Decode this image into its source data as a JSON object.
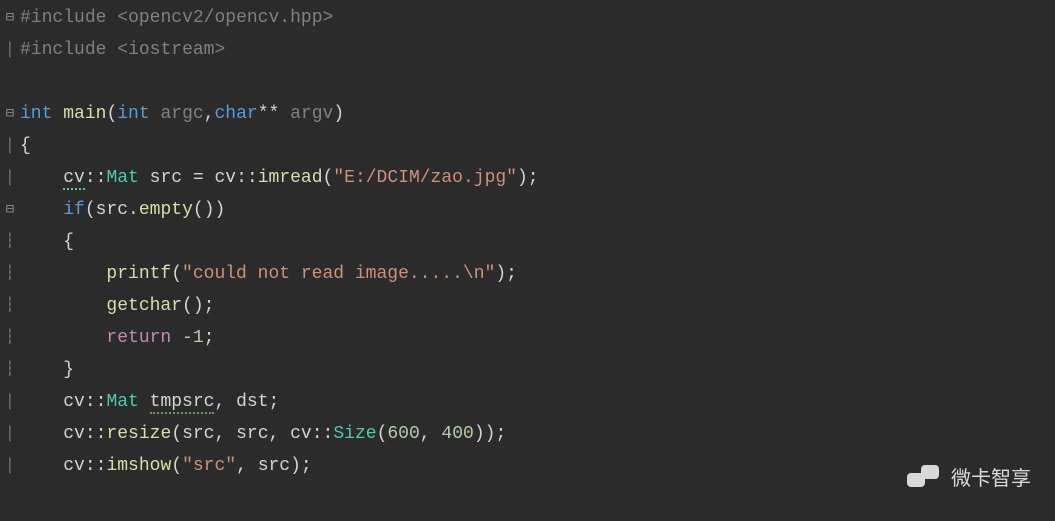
{
  "code": {
    "l1": {
      "hash": "#",
      "include": "include",
      "open": "<",
      "path": "opencv2/opencv.hpp",
      "close": ">"
    },
    "l2": {
      "hash": "#",
      "include": "include",
      "open": "<",
      "path": "iostream",
      "close": ">"
    },
    "l4": {
      "kw_int": "int",
      "main": "main",
      "lp": "(",
      "kw_int2": "int",
      "argc": "argc",
      "comma": ",",
      "kw_char": "char",
      "stars": "**",
      "argv": "argv",
      "rp": ")"
    },
    "l5": {
      "brace": "{"
    },
    "l6": {
      "ns": "cv",
      "dcolon": "::",
      "cls": "Mat",
      "var": "src",
      "eq": "=",
      "ns2": "cv",
      "dcolon2": "::",
      "fn": "imread",
      "lp": "(",
      "str": "\"E:/DCIM/zao.jpg\"",
      "rp": ")",
      "semi": ";"
    },
    "l7": {
      "kw_if": "if",
      "lp": "(",
      "var": "src",
      "dot": ".",
      "fn": "empty",
      "lp2": "(",
      "rp2": ")",
      "rp": ")"
    },
    "l8": {
      "brace": "{"
    },
    "l9": {
      "fn": "printf",
      "lp": "(",
      "str": "\"could not read image.....\\n\"",
      "rp": ")",
      "semi": ";"
    },
    "l10": {
      "fn": "getchar",
      "lp": "(",
      "rp": ")",
      "semi": ";"
    },
    "l11": {
      "kw": "return",
      "sp": " ",
      "num": "-1",
      "semi": ";"
    },
    "l12": {
      "brace": "}"
    },
    "l13": {
      "ns": "cv",
      "dcolon": "::",
      "cls": "Mat",
      "var": "tmpsrc",
      "comma": ",",
      "var2": "dst",
      "semi": ";"
    },
    "l14": {
      "ns": "cv",
      "dcolon": "::",
      "fn": "resize",
      "lp": "(",
      "a1": "src",
      "c1": ",",
      "a2": "src",
      "c2": ",",
      "ns2": "cv",
      "dcolon2": "::",
      "cls": "Size",
      "lp2": "(",
      "n1": "600",
      "c3": ",",
      "n2": "400",
      "rp2": ")",
      "rp": ")",
      "semi": ";"
    },
    "l15": {
      "ns": "cv",
      "dcolon": "::",
      "fn": "imshow",
      "lp": "(",
      "str": "\"src\"",
      "c": ",",
      "a": "src",
      "rp": ")",
      "semi": ";"
    }
  },
  "watermark": {
    "text": "微卡智享"
  }
}
